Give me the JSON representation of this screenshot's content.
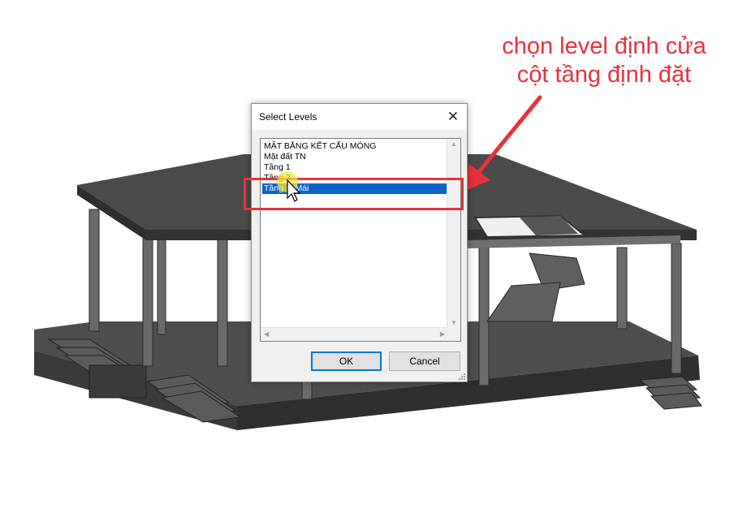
{
  "annotation": {
    "line1": "chọn level định cửa",
    "line2": "cột  tầng định đặt",
    "color": "#e8323a"
  },
  "dialog": {
    "title": "Select Levels",
    "close_icon": "close-icon",
    "levels": [
      {
        "label": "MẶT BẰNG KẾT CẤU MÓNG",
        "selected": false
      },
      {
        "label": "Mặt đất TN",
        "selected": false
      },
      {
        "label": "Tầng 1",
        "selected": false
      },
      {
        "label": "Tầng 2",
        "selected": false
      },
      {
        "label": "Tầng ... Mái",
        "selected": true
      }
    ],
    "ok_label": "OK",
    "cancel_label": "Cancel",
    "selection_color": "#0a64cc"
  }
}
